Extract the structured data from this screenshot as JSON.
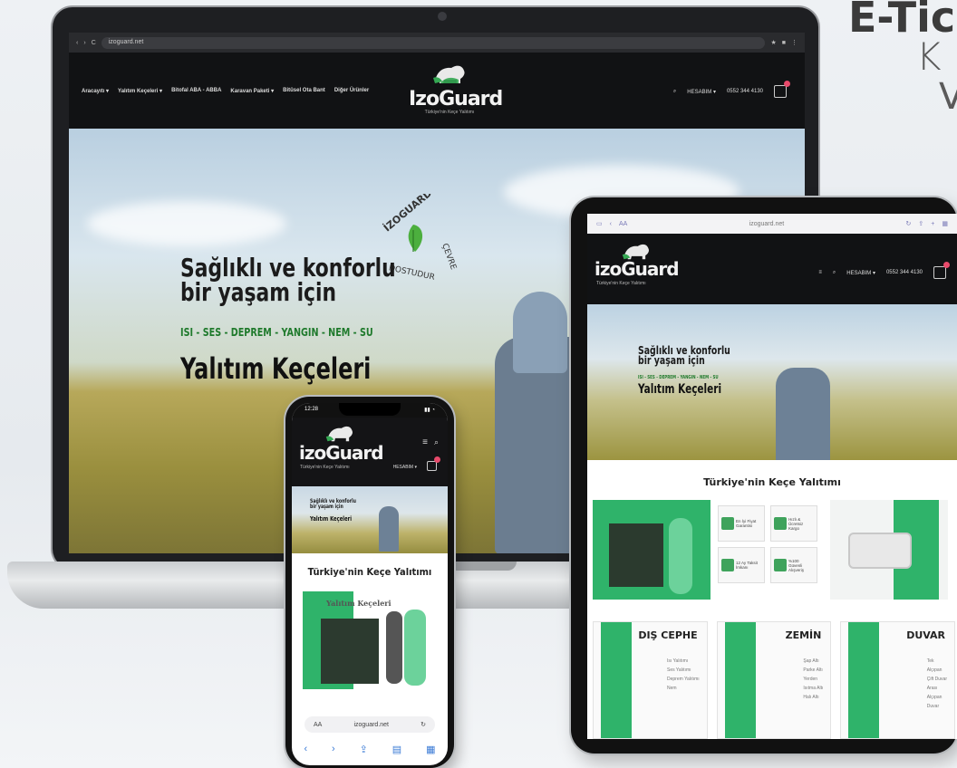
{
  "headline": {
    "line1": "E-Tic",
    "line2": "K",
    "line3": "V"
  },
  "laptop": {
    "browser": {
      "url": "izoguard.net"
    },
    "nav": {
      "links": [
        "Aracayıtı ▾",
        "Yalıtım Keçeleri ▾",
        "Bitofal ABA - ABBA",
        "Karavan Paketi ▾",
        "Bitüsel Ota Bant",
        "Diğer Ürünler"
      ],
      "account": "HESABIM ▾",
      "phone": "0552 344 4130"
    },
    "logo": {
      "name": "IzoGuard",
      "tagline": "Türkiye'nin Keçe Yalıtımı"
    },
    "hero": {
      "title_line1": "Sağlıklı ve konforlu",
      "title_line2": "bir yaşam için",
      "tags": "ISI - SES - DEPREM - YANGIN - NEM - SU",
      "product": "Yalıtım Keçeleri",
      "stamp_top": "İZOGUARD",
      "stamp_right": "ÇEVRE",
      "stamp_bottom": "DOSTUDUR"
    }
  },
  "tablet": {
    "browser": {
      "aa": "AA",
      "url": "izoguard.net"
    },
    "logo": {
      "name": "izoGuard",
      "tagline": "Türkiye'nin Keçe Yalıtımı"
    },
    "nav": {
      "account": "HESABIM ▾",
      "phone": "0552 344 4130"
    },
    "hero": {
      "title_line1": "Sağlıklı ve konforlu",
      "title_line2": "bir yaşam için",
      "tags": "ISI - SES - DEPREM - YANGIN - NEM - SU",
      "product": "Yalıtım Keçeleri"
    },
    "section_title": "Türkiye'nin Keçe Yalıtımı",
    "features": [
      {
        "label": "En İyi Fiyat Garantisi"
      },
      {
        "label": "Hızlı & Ücretsiz Kargo"
      },
      {
        "label": "12 Ay Taksit İmkanı"
      },
      {
        "label": "%100 Güvenli Alışveriş"
      }
    ],
    "categories": [
      {
        "title": "DIŞ CEPHE",
        "items": [
          "Isı Yalıtımı",
          "Ses Yalıtımı",
          "Deprem Yalıtımı",
          "Nem"
        ]
      },
      {
        "title": "ZEMİN",
        "items": [
          "Şap Altı",
          "Parke Altı",
          "Yerden",
          "Isıtma Altı",
          "Halı Altı"
        ]
      },
      {
        "title": "DUVAR",
        "items": [
          "Tek",
          "Alçıpan",
          "Çift Duvar",
          "Arası",
          "Alçıpan",
          "Duvar"
        ]
      }
    ]
  },
  "phone": {
    "time": "12:28",
    "logo": {
      "name": "izoGuard",
      "tagline": "Türkiye'nin Keçe Yalıtımı"
    },
    "nav": {
      "account": "HESABIM ▾"
    },
    "hero": {
      "title_line1": "Sağlıklı ve konforlu",
      "title_line2": "bir yaşam için",
      "product": "Yalıtım Keçeleri"
    },
    "section_title": "Türkiye'nin Keçe Yalıtımı",
    "product_label": "Yalıtım Keçeleri",
    "url_bar": {
      "aa": "AA",
      "url": "izoguard.net"
    }
  },
  "colors": {
    "brand_green": "#33a852",
    "nav_dark": "#111214",
    "accent_pink": "#e84a6b"
  }
}
